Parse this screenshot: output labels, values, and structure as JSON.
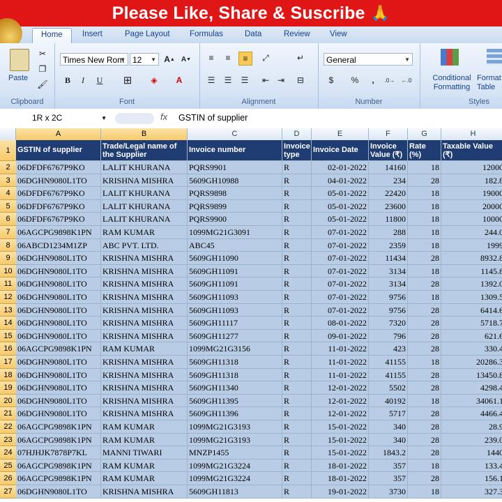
{
  "banner": {
    "text": "Please Like, Share & Suscribe",
    "emoji": "🙏"
  },
  "tabs": [
    "Home",
    "Insert",
    "Page Layout",
    "Formulas",
    "Data",
    "Review",
    "View"
  ],
  "ribbon": {
    "paste_label": "Paste",
    "font_name": "Times New Rom",
    "font_size": "12",
    "number_format": "General",
    "conditional_formatting": "Conditional Formatting",
    "format_as_table": "Format as Table",
    "groups": {
      "clipboard": "Clipboard",
      "font": "Font",
      "alignment": "Alignment",
      "number": "Number",
      "styles": "Styles"
    }
  },
  "formula_bar": {
    "name_box": "1R x 2C",
    "fx": "fx",
    "content": "GSTIN of supplier"
  },
  "columns": [
    "A",
    "B",
    "C",
    "D",
    "E",
    "F",
    "G",
    "H"
  ],
  "header_row": {
    "number": "1",
    "cells": [
      "GSTIN of supplier",
      "Trade/Legal name of the Supplier",
      "Invoice number",
      "Invoice type",
      "Invoice Date",
      "Invoice Value (₹)",
      "Rate (%)",
      "Taxable Value (₹)"
    ]
  },
  "rows": [
    {
      "n": "2",
      "cells": [
        "06DFDF6767P9KO",
        "LALIT KHURANA",
        "PQRS9901",
        "R",
        "02-01-2022",
        "14160",
        "18",
        "12000"
      ]
    },
    {
      "n": "3",
      "cells": [
        "06DGHN9080L1TO",
        "KRISHNA MISHRA",
        "5609GH10988",
        "R",
        "04-01-2022",
        "234",
        "28",
        "182.8"
      ]
    },
    {
      "n": "4",
      "cells": [
        "06DFDF6767P9KO",
        "LALIT KHURANA",
        "PQRS9898",
        "R",
        "05-01-2022",
        "22420",
        "18",
        "19000"
      ]
    },
    {
      "n": "5",
      "cells": [
        "06DFDF6767P9KO",
        "LALIT KHURANA",
        "PQRS9899",
        "R",
        "05-01-2022",
        "23600",
        "18",
        "20000"
      ]
    },
    {
      "n": "6",
      "cells": [
        "06DFDF6767P9KO",
        "LALIT KHURANA",
        "PQRS9900",
        "R",
        "05-01-2022",
        "11800",
        "18",
        "10000"
      ]
    },
    {
      "n": "7",
      "cells": [
        "06AGCPG9898K1PN",
        "RAM KUMAR",
        "1099MG21G3091",
        "R",
        "07-01-2022",
        "288",
        "18",
        "244.0"
      ]
    },
    {
      "n": "8",
      "cells": [
        "06ABCD1234M1ZP",
        "ABC PVT. LTD.",
        "ABC45",
        "R",
        "07-01-2022",
        "2359",
        "18",
        "1999"
      ]
    },
    {
      "n": "9",
      "cells": [
        "06DGHN9080L1TO",
        "KRISHNA MISHRA",
        "5609GH11090",
        "R",
        "07-01-2022",
        "11434",
        "28",
        "8932.8"
      ]
    },
    {
      "n": "10",
      "cells": [
        "06DGHN9080L1TO",
        "KRISHNA MISHRA",
        "5609GH11091",
        "R",
        "07-01-2022",
        "3134",
        "18",
        "1145.8"
      ]
    },
    {
      "n": "11",
      "cells": [
        "06DGHN9080L1TO",
        "KRISHNA MISHRA",
        "5609GH11091",
        "R",
        "07-01-2022",
        "3134",
        "28",
        "1392.0"
      ]
    },
    {
      "n": "12",
      "cells": [
        "06DGHN9080L1TO",
        "KRISHNA MISHRA",
        "5609GH11093",
        "R",
        "07-01-2022",
        "9756",
        "18",
        "1309.5"
      ]
    },
    {
      "n": "13",
      "cells": [
        "06DGHN9080L1TO",
        "KRISHNA MISHRA",
        "5609GH11093",
        "R",
        "07-01-2022",
        "9756",
        "28",
        "6414.6"
      ]
    },
    {
      "n": "14",
      "cells": [
        "06DGHN9080L1TO",
        "KRISHNA MISHRA",
        "5609GH11117",
        "R",
        "08-01-2022",
        "7320",
        "28",
        "5718.7"
      ]
    },
    {
      "n": "15",
      "cells": [
        "06DGHN9080L1TO",
        "KRISHNA MISHRA",
        "5609GH11277",
        "R",
        "09-01-2022",
        "796",
        "28",
        "621.6"
      ]
    },
    {
      "n": "16",
      "cells": [
        "06AGCPG9898K1PN",
        "RAM KUMAR",
        "1099MG21G3156",
        "R",
        "11-01-2022",
        "423",
        "28",
        "330.4"
      ]
    },
    {
      "n": "17",
      "cells": [
        "06DGHN9080L1TO",
        "KRISHNA MISHRA",
        "5609GH11318",
        "R",
        "11-01-2022",
        "41155",
        "18",
        "20286.3"
      ]
    },
    {
      "n": "18",
      "cells": [
        "06DGHN9080L1TO",
        "KRISHNA MISHRA",
        "5609GH11318",
        "R",
        "11-01-2022",
        "41155",
        "28",
        "13450.8"
      ]
    },
    {
      "n": "19",
      "cells": [
        "06DGHN9080L1TO",
        "KRISHNA MISHRA",
        "5609GH11340",
        "R",
        "12-01-2022",
        "5502",
        "28",
        "4298.4"
      ]
    },
    {
      "n": "20",
      "cells": [
        "06DGHN9080L1TO",
        "KRISHNA MISHRA",
        "5609GH11395",
        "R",
        "12-01-2022",
        "40192",
        "18",
        "34061.1"
      ]
    },
    {
      "n": "21",
      "cells": [
        "06DGHN9080L1TO",
        "KRISHNA MISHRA",
        "5609GH11396",
        "R",
        "12-01-2022",
        "5717",
        "28",
        "4466.4"
      ]
    },
    {
      "n": "22",
      "cells": [
        "06AGCPG9898K1PN",
        "RAM KUMAR",
        "1099MG21G3193",
        "R",
        "15-01-2022",
        "340",
        "28",
        "28.9"
      ]
    },
    {
      "n": "23",
      "cells": [
        "06AGCPG9898K1PN",
        "RAM KUMAR",
        "1099MG21G3193",
        "R",
        "15-01-2022",
        "340",
        "28",
        "239.0"
      ]
    },
    {
      "n": "24",
      "cells": [
        "07HJHJK7878P7KL",
        "MANNI TIWARI",
        "MNZP1455",
        "R",
        "15-01-2022",
        "1843.2",
        "28",
        "1440"
      ]
    },
    {
      "n": "25",
      "cells": [
        "06AGCPG9898K1PN",
        "RAM KUMAR",
        "1099MG21G3224",
        "R",
        "18-01-2022",
        "357",
        "18",
        "133.4"
      ]
    },
    {
      "n": "26",
      "cells": [
        "06AGCPG9898K1PN",
        "RAM KUMAR",
        "1099MG21G3224",
        "R",
        "18-01-2022",
        "357",
        "28",
        "156.1"
      ]
    },
    {
      "n": "27",
      "cells": [
        "06DGHN9080L1TO",
        "KRISHNA MISHRA",
        "5609GH11813",
        "R",
        "19-01-2022",
        "3730",
        "18",
        "327.3"
      ]
    }
  ]
}
